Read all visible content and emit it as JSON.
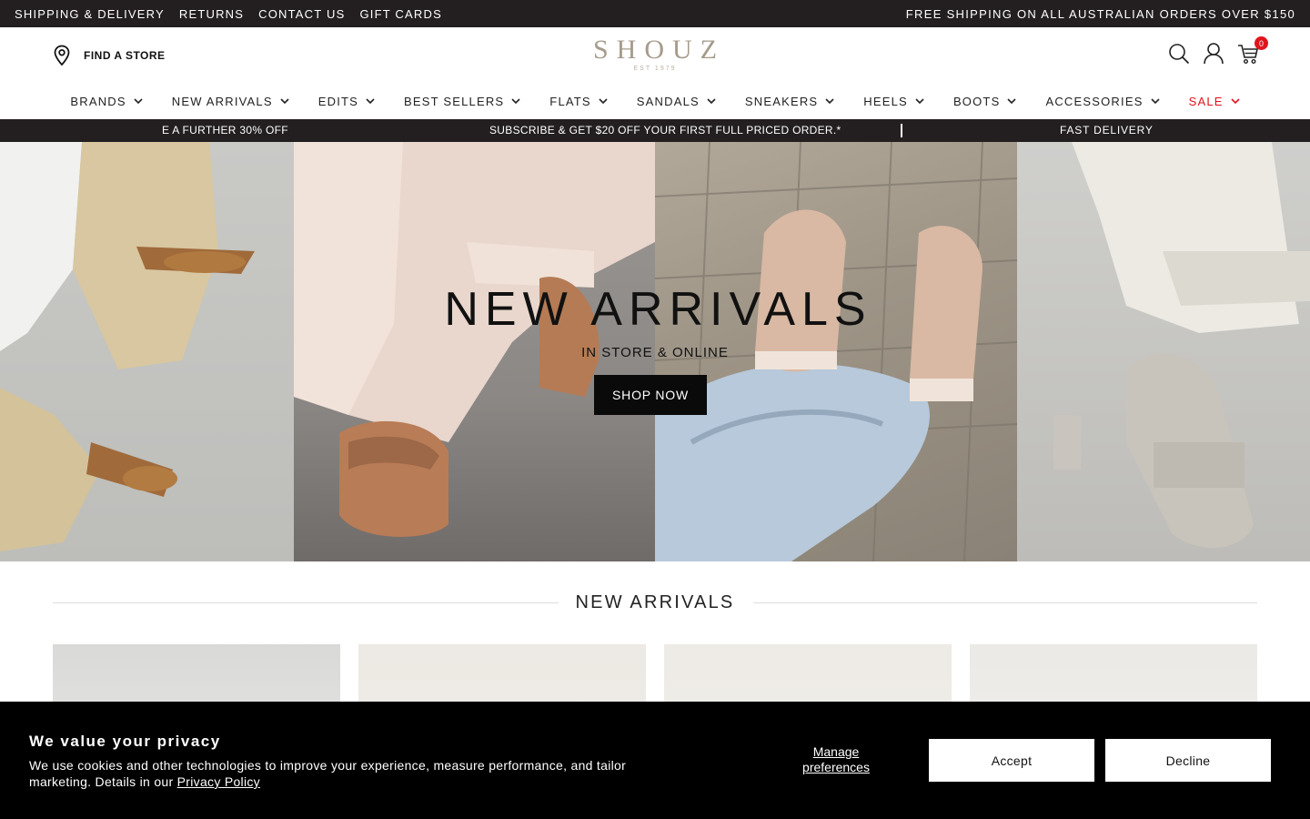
{
  "topbar": {
    "links": [
      "SHIPPING & DELIVERY",
      "RETURNS",
      "CONTACT US",
      "GIFT CARDS"
    ],
    "promo": "FREE SHIPPING ON ALL AUSTRALIAN ORDERS OVER $150"
  },
  "header": {
    "find_store": "FIND A STORE",
    "logo": "SHOUZ",
    "logo_est": "EST 1979",
    "cart_count": "0"
  },
  "nav": {
    "items": [
      "BRANDS",
      "NEW ARRIVALS",
      "EDITS",
      "BEST SELLERS",
      "FLATS",
      "SANDALS",
      "SNEAKERS",
      "HEELS",
      "BOOTS",
      "ACCESSORIES",
      "SALE"
    ]
  },
  "marquee": {
    "item1": "E A FURTHER 30% OFF",
    "item2": "SUBSCRIBE & GET $20 OFF YOUR FIRST FULL PRICED ORDER.*",
    "item3": "FAST DELIVERY"
  },
  "hero": {
    "title": "NEW ARRIVALS",
    "subtitle": "IN STORE & ONLINE",
    "button": "SHOP NOW"
  },
  "section": {
    "title": "NEW ARRIVALS"
  },
  "cookie": {
    "title": "We value your privacy",
    "text": "We use cookies and other technologies to improve your experience, measure performance, and tailor marketing. Details in our ",
    "link": "Privacy Policy",
    "manage": "Manage preferences",
    "accept": "Accept",
    "decline": "Decline"
  }
}
